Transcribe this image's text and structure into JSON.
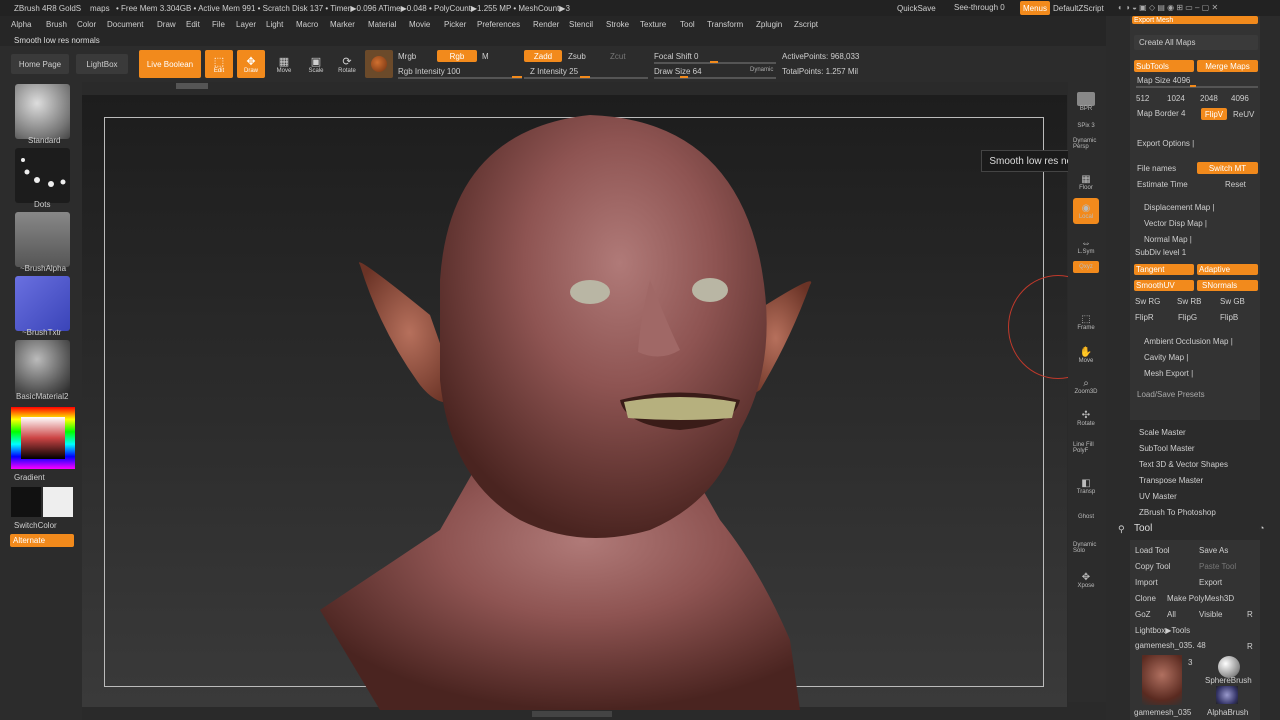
{
  "titlebar": {
    "app": "ZBrush 4R8 GoldS",
    "doc": "maps",
    "stats": "• Free Mem 3.304GB • Active Mem 991 • Scratch Disk 137 • Timer▶0.096 ATime▶0.048 • PolyCount▶1.255 MP • MeshCount▶3",
    "quicksave": "QuickSave",
    "seethrough": "See-through 0",
    "menus": "Menus",
    "defaultzscript": "DefaultZScript"
  },
  "menu": [
    "Alpha",
    "Brush",
    "Color",
    "Document",
    "Draw",
    "Edit",
    "File",
    "Layer",
    "Light",
    "Macro",
    "Marker",
    "Material",
    "Movie",
    "Picker",
    "Preferences",
    "Render",
    "Stencil",
    "Stroke",
    "Texture",
    "Tool",
    "Transform",
    "Zplugin",
    "Zscript"
  ],
  "status_text": "Smooth low res normals",
  "toolbar": {
    "home": "Home Page",
    "lightbox": "LightBox",
    "livebool": "Live Boolean",
    "edit": "Edit",
    "draw": "Draw",
    "move": "Move",
    "scale": "Scale",
    "rotate": "Rotate",
    "mrgb": "Mrgb",
    "rgb": "Rgb",
    "m": "M",
    "rgbint": "Rgb Intensity 100",
    "zadd": "Zadd",
    "zsub": "Zsub",
    "zcut": "Zcut",
    "zint": "Z Intensity 25",
    "focal": "Focal Shift 0",
    "drawsize": "Draw Size 64",
    "dynamic": "Dynamic",
    "activepoints": "ActivePoints: 968,033",
    "totalpoints": "TotalPoints: 1.257 Mil"
  },
  "left": {
    "standard": "Standard",
    "dots": "Dots",
    "brushalpha": "~BrushAlpha",
    "brushtxtr": "~BrushTxtr",
    "material": "BasicMaterial2",
    "gradient": "Gradient",
    "switchcolor": "SwitchColor",
    "alternate": "Alternate"
  },
  "right_shelf": [
    "BPR",
    "SPix 3",
    "Dynamic Persp",
    "Floor",
    "Local",
    "L.Sym",
    "Qxyz",
    "Frame",
    "Move",
    "Zoom3D",
    "Rotate",
    "Line Fill PolyF",
    "Transp",
    "Ghost",
    "Dynamic Solo",
    "Xpose"
  ],
  "tooltip": "Smooth low res normals",
  "tray": {
    "exportmesh": "Export Mesh",
    "createall": "Create All Maps",
    "subtools": "SubTools",
    "mergemaps": "Merge Maps",
    "mapsize": "Map Size 4096",
    "sizes": [
      "512",
      "1024",
      "2048",
      "4096"
    ],
    "mapborder": "Map Border 4",
    "flipv": "FlipV",
    "reuv": "ReUV",
    "exportopts": "Export Options |",
    "filenames": "File names",
    "switchmt": "Switch MT",
    "estimate": "Estimate Time",
    "reset": "Reset",
    "dispmap": "Displacement Map |",
    "vectordisp": "Vector Disp Map |",
    "normalmap": "Normal Map |",
    "subdiv": "SubDiv level 1",
    "tangent": "Tangent",
    "adaptive": "Adaptive",
    "smoothuv": "SmoothUV",
    "snormals": "SNormals",
    "swrg": "Sw RG",
    "swrb": "Sw RB",
    "swgb": "Sw GB",
    "flipr": "FlipR",
    "flipg": "FlipG",
    "flipb": "FlipB",
    "ao": "Ambient Occlusion Map |",
    "cavity": "Cavity Map |",
    "meshexport": "Mesh Export |",
    "loadsave": "Load/Save Presets",
    "plugins": [
      "Scale Master",
      "SubTool Master",
      "Text 3D & Vector Shapes",
      "Transpose Master",
      "UV Master",
      "ZBrush To Photoshop"
    ],
    "tool": "Tool",
    "loadtool": "Load Tool",
    "saveas": "Save As",
    "copytool": "Copy Tool",
    "pastetool": "Paste Tool",
    "import": "Import",
    "export": "Export",
    "clone": "Clone",
    "makepoly": "Make PolyMesh3D",
    "goz": "GoZ",
    "all": "All",
    "visible": "Visible",
    "r": "R",
    "lightboxtools": "Lightbox▶Tools",
    "mesh": "gamemesh_035. 48",
    "r2": "R",
    "num": "3",
    "spherebrush": "SphereBrush",
    "alphabrush": "AlphaBrush",
    "mesh2": "gamemesh_035"
  }
}
